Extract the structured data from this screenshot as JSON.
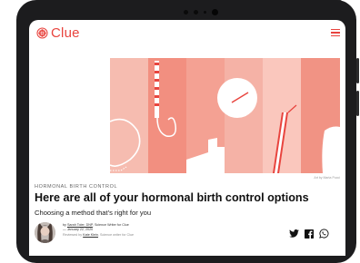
{
  "brand": {
    "name": "Clue",
    "accent_color": "#e8443e"
  },
  "header": {
    "logo_icon": "clue-flower-icon",
    "menu_icon": "hamburger-menu-icon"
  },
  "hero": {
    "credit": "Art by Marta Pucci"
  },
  "article": {
    "category": "HORMONAL BIRTH CONTROL",
    "title": "Here are all of your hormonal birth control options",
    "subtitle": "Choosing a method that's right for you"
  },
  "byline": {
    "by": "by",
    "author": "Sarah Toler, DNP",
    "author_role": ", Science Writer for Clue",
    "date": "— January 22, 2020",
    "reviewed_prefix": "Reviewed by",
    "reviewer": "Kate Klein",
    "reviewer_role": ", Science writer for Clue"
  },
  "share": {
    "icons": [
      "twitter-icon",
      "facebook-icon",
      "whatsapp-icon"
    ]
  }
}
